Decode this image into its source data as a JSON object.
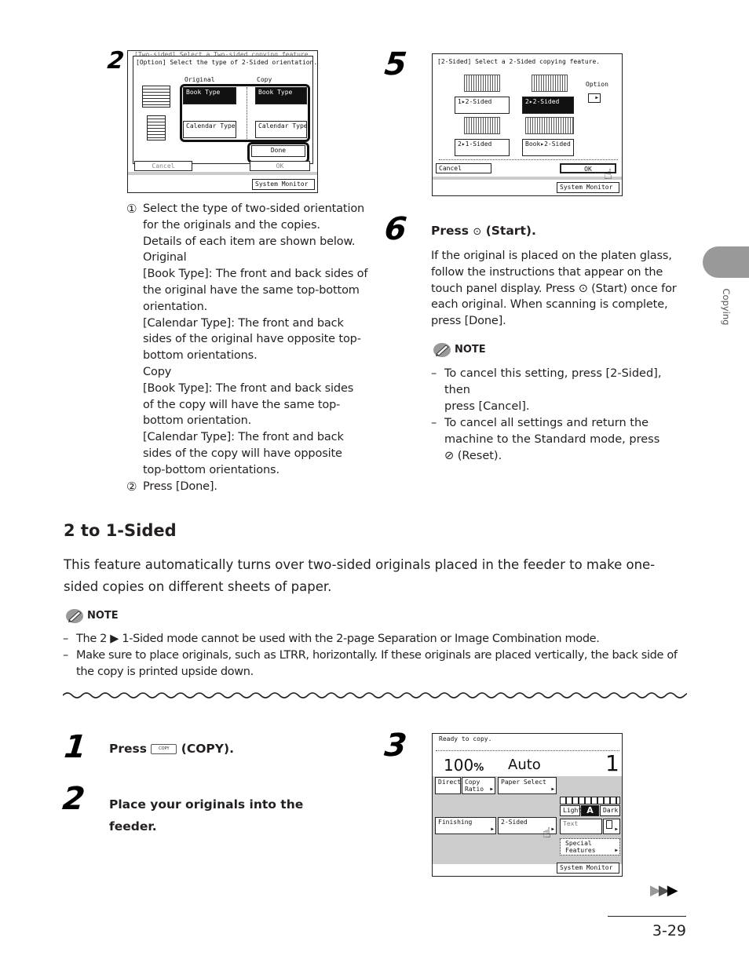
{
  "side_tab": {
    "label": "Copying",
    "color": "#999999"
  },
  "top_left": {
    "step_number": "2",
    "screen": {
      "title_behind": "[Two-sided] Select a Two-sided copying feature.",
      "title": "[Option] Select the type of 2-Sided orientation.",
      "original_header": "Original",
      "copy_header": "Copy",
      "original_book": "Book Type",
      "original_calendar": "Calendar Type",
      "copy_book": "Book Type",
      "copy_calendar": "Calendar Type",
      "done": "Done",
      "cancel": "Cancel",
      "ok": "OK",
      "system_monitor": "System Monitor"
    },
    "sub_steps": [
      {
        "marker": "①",
        "lines": [
          "Select the type of two-sided orientation",
          "for the originals and the copies.",
          "Details of each item are shown below.",
          "Original",
          "[Book Type]: The front and back sides of",
          "the original have the same top-bottom",
          "orientation.",
          "[Calendar Type]: The front and back",
          "sides of the original have opposite top-",
          "bottom orientations.",
          "Copy",
          "[Book Type]: The front and back sides",
          "of the copy will have the same top-",
          "bottom orientation.",
          "[Calendar Type]: The front and back",
          "sides of the copy will have opposite",
          "top-bottom orientations."
        ]
      },
      {
        "marker": "②",
        "lines": [
          "Press [Done]."
        ]
      }
    ]
  },
  "top_right": {
    "step5": {
      "step_number": "5",
      "screen": {
        "title": "[2-Sided] Select a 2-Sided copying feature.",
        "opt_1to2": "1▸2-Sided",
        "opt_2to2": "2▸2-Sided",
        "opt_2to1": "2▸1-Sided",
        "opt_book": "Book▸2-Sided",
        "option": "Option",
        "cancel": "Cancel",
        "ok": "OK",
        "system_monitor": "System Monitor"
      }
    },
    "step6": {
      "step_number": "6",
      "heading_pre": "Press",
      "heading_icon": "⊙",
      "heading_post": "(Start).",
      "body_lines": [
        "If the original is placed on the platen glass,",
        "follow the instructions that appear on the",
        "touch panel display. Press ⊙ (Start) once for",
        "each original. When scanning is complete,",
        "press [Done]."
      ],
      "note_label": "NOTE",
      "notes": [
        [
          "To cancel this setting, press [2-Sided], then",
          "press [Cancel]."
        ],
        [
          "To cancel all settings and return the",
          "machine to the Standard mode, press",
          "⊘ (Reset)."
        ]
      ]
    }
  },
  "section": {
    "heading": "2 to 1-Sided",
    "intro_lines": [
      "This feature automatically turns over two-sided originals placed in the feeder to make one-",
      "sided copies on different sheets of paper."
    ],
    "note_label": "NOTE",
    "notes": [
      [
        "The 2 ▶ 1-Sided mode cannot be used with the 2-page Separation or Image Combination mode."
      ],
      [
        "Make sure to place originals, such as LTRR, horizontally. If these originals are placed vertically, the back side of",
        "the copy is printed upside down."
      ]
    ]
  },
  "bottom": {
    "step1": {
      "number": "1",
      "pre": "Press",
      "key_label": "COPY",
      "post": "(COPY)."
    },
    "step2": {
      "number": "2",
      "lines": [
        "Place your originals into the",
        "feeder."
      ]
    },
    "step3": {
      "number": "3",
      "screen": {
        "status": "Ready to copy.",
        "ratio": "100",
        "ratio_unit": "%",
        "paper": "Auto",
        "count": "1",
        "direct": "Direct",
        "copy_ratio_1": "Copy",
        "copy_ratio_2": "Ratio",
        "paper_select": "Paper Select",
        "light": "Light",
        "auto_a": "A",
        "dark": "Dark",
        "finishing": "Finishing",
        "two_sided": "2-Sided",
        "text": "Text",
        "special_1": "Special",
        "special_2": "Features",
        "system_monitor": "System Monitor"
      }
    }
  },
  "footer": {
    "continue_arrows": "▶▶▶",
    "page_number": "3-29"
  }
}
